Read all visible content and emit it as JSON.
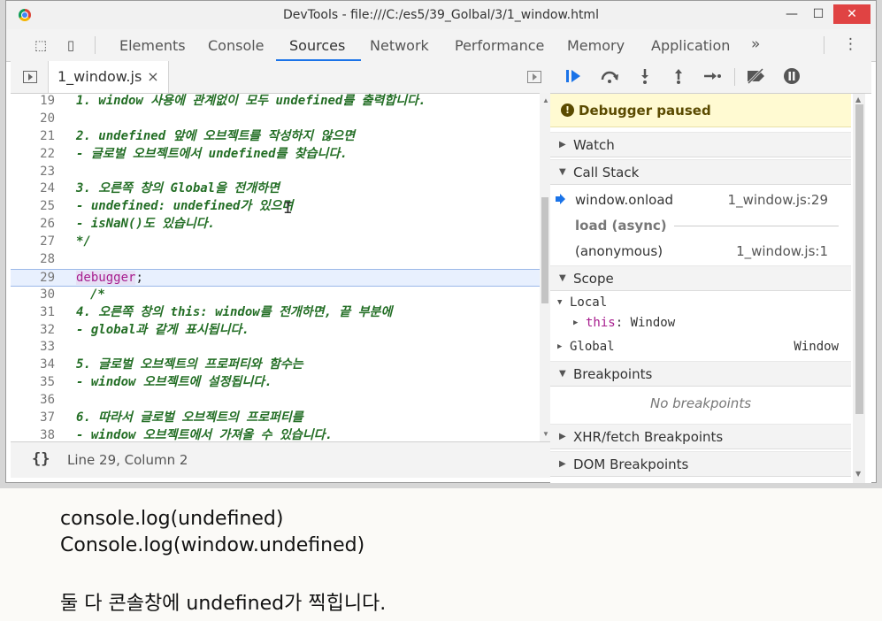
{
  "window": {
    "title": "DevTools - file:///C:/es5/39_Golbal/3/1_window.html",
    "minimize": "—",
    "maximize": "☐",
    "close": "✕"
  },
  "toolbar": {
    "inspect_icon": "⬚",
    "device_icon": "▯",
    "tabs": [
      "Elements",
      "Console",
      "Sources",
      "Network",
      "Performance",
      "Memory",
      "Application"
    ],
    "active_tab": "Sources",
    "more": "»",
    "menu": "⋮"
  },
  "editor": {
    "file_tab": "1_window.js",
    "close": "×",
    "lines": [
      {
        "n": "19",
        "text": "1. window 사용에 관계없이 모두 undefined를 출력합니다."
      },
      {
        "n": "20",
        "text": ""
      },
      {
        "n": "21",
        "text": "2. undefined 앞에 오브젝트를 작성하지 않으면"
      },
      {
        "n": "22",
        "text": "- 글로벌 오브젝트에서 undefined를 찾습니다."
      },
      {
        "n": "23",
        "text": ""
      },
      {
        "n": "24",
        "text": "3. 오른쪽 창의 Global을 전개하면"
      },
      {
        "n": "25",
        "text": "- undefined: undefined가 있으며"
      },
      {
        "n": "26",
        "text": "- isNaN()도 있습니다."
      },
      {
        "n": "27",
        "text": "*/"
      },
      {
        "n": "28",
        "text": ""
      },
      {
        "n": "29",
        "text": "debugger;"
      },
      {
        "n": "30",
        "text": "/*"
      },
      {
        "n": "31",
        "text": "4. 오른쪽 창의 this: window를 전개하면, 끝 부분에"
      },
      {
        "n": "32",
        "text": "- global과 같게 표시됩니다."
      },
      {
        "n": "33",
        "text": ""
      },
      {
        "n": "34",
        "text": "5. 글로벌 오브젝트의 프로퍼티와 함수는"
      },
      {
        "n": "35",
        "text": "- window 오브젝트에 설정됩니다."
      },
      {
        "n": "36",
        "text": ""
      },
      {
        "n": "37",
        "text": "6. 따라서 글로벌 오브젝트의 프로퍼티를"
      },
      {
        "n": "38",
        "text": "- window 오브젝트에서 가져올 수 있습니다."
      }
    ],
    "current": {
      "keyword": "debugger",
      "rest": ";"
    },
    "text_cursor": "I",
    "status": {
      "icon": "{}",
      "position": "Line 29, Column 2"
    }
  },
  "debugger": {
    "paused_icon": "!",
    "paused": "Debugger paused",
    "watch": "Watch",
    "call_stack": "Call Stack",
    "frames": [
      {
        "name": "window.onload",
        "location": "1_window.js:29"
      },
      {
        "name": "(anonymous)",
        "location": "1_window.js:1"
      }
    ],
    "async_label": "load (async)",
    "scope": "Scope",
    "local": "Local",
    "this_key": "this",
    "this_value": "Window",
    "global": "Global",
    "global_value": "Window",
    "breakpoints": "Breakpoints",
    "no_breakpoints": "No breakpoints",
    "xhr": "XHR/fetch Breakpoints",
    "dom": "DOM Breakpoints"
  },
  "notes": {
    "line1": "console.log(undefined)",
    "line2": "Console.log(window.undefined)",
    "line3": "둘 다 콘솔창에 undefined가 찍힙니다."
  },
  "colors": {
    "accent": "#1a73e8",
    "comment_green": "#236e25",
    "keyword_purple": "#a71d8e",
    "paused_bg": "#fffad2"
  }
}
